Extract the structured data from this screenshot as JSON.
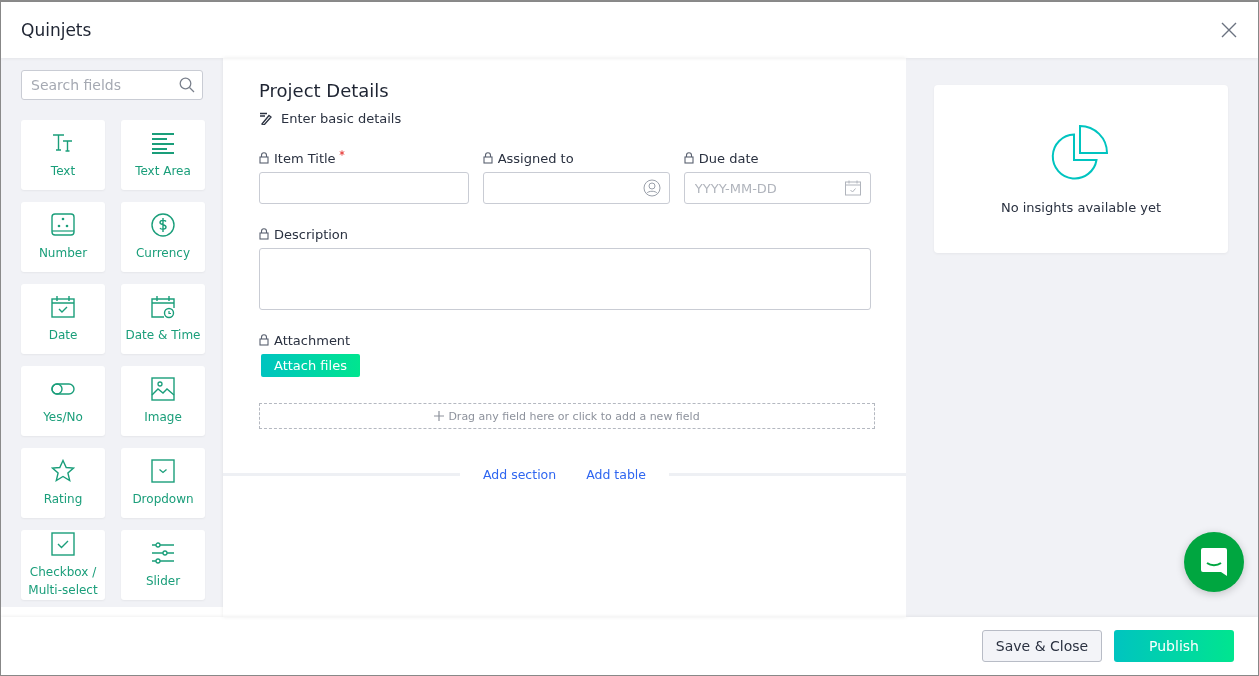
{
  "window": {
    "title": "Quinjets"
  },
  "palette": {
    "search": {
      "placeholder": "Search fields"
    },
    "items": [
      {
        "label": "Text",
        "kind": "text"
      },
      {
        "label": "Text Area",
        "kind": "textarea"
      },
      {
        "label": "Number",
        "kind": "number"
      },
      {
        "label": "Currency",
        "kind": "currency"
      },
      {
        "label": "Date",
        "kind": "date"
      },
      {
        "label": "Date & Time",
        "kind": "datetime"
      },
      {
        "label": "Yes/No",
        "kind": "toggle"
      },
      {
        "label": "Image",
        "kind": "image"
      },
      {
        "label": "Rating",
        "kind": "rating"
      },
      {
        "label": "Dropdown",
        "kind": "dropdown"
      },
      {
        "label": "Checkbox / Multi-select",
        "kind": "checkbox"
      },
      {
        "label": "Slider",
        "kind": "slider"
      }
    ]
  },
  "section": {
    "title": "Project Details",
    "subtitle": "Enter basic details",
    "fields": [
      {
        "label": "Item Title",
        "required": true,
        "kind": "text"
      },
      {
        "label": "Assigned to",
        "required": false,
        "kind": "person"
      },
      {
        "label": "Due date",
        "required": false,
        "kind": "date",
        "placeholder": "YYYY-MM-DD"
      },
      {
        "label": "Description",
        "required": false,
        "kind": "textarea"
      },
      {
        "label": "Attachment",
        "required": false,
        "kind": "attachment",
        "button": "Attach files"
      }
    ],
    "drop_hint": "Drag any field here or click to add a new field",
    "add_links": [
      "Add section",
      "Add table"
    ]
  },
  "insights": {
    "message": "No insights available yet"
  },
  "footer": {
    "buttons": [
      {
        "label": "Save & Close",
        "kind": "secondary"
      },
      {
        "label": "Publish",
        "kind": "primary"
      }
    ]
  }
}
